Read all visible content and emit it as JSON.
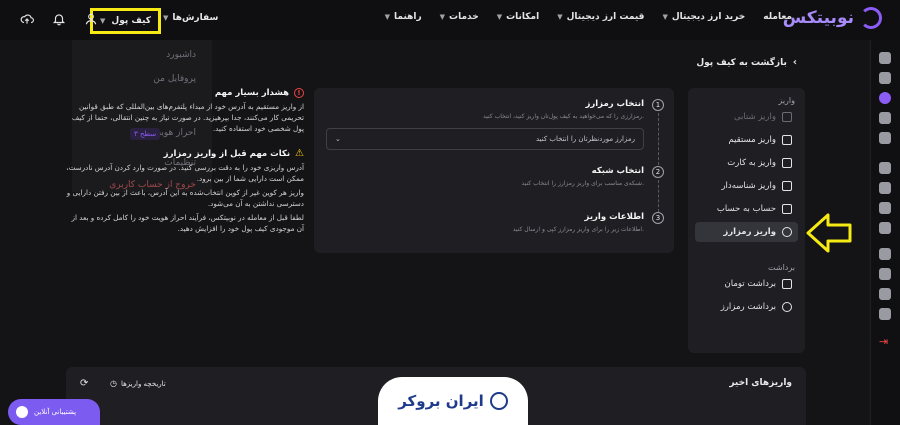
{
  "brand": {
    "name": "نوبیتکس",
    "accent": "#8b5cf6"
  },
  "nav": {
    "items": [
      "معامله",
      "خرید ارز دیجیتال",
      "قیمت ارز دیجیتال",
      "امکانات",
      "خدمات",
      "راهنما"
    ],
    "orders": "سفارش‌ها",
    "wallet": "کیف پول"
  },
  "dropdown": {
    "items": [
      "داشبورد",
      "پروفایل من",
      "احراز هویت",
      "تنظیمات",
      "خروج از حساب کاربری"
    ],
    "level_badge": "سطح ۳"
  },
  "back": "بازگشت به کیف پول",
  "sidemenu": {
    "deposit_section": "واریز",
    "deposit_items": [
      "واریز شتابی",
      "واریز مستقیم",
      "واریز به کارت",
      "واریز شناسه‌دار",
      "حساب به حساب",
      "واریز رمزارز"
    ],
    "withdraw_section": "برداشت",
    "withdraw_items": [
      "برداشت تومان",
      "برداشت رمزارز"
    ]
  },
  "steps": [
    {
      "num": "1",
      "title": "انتخاب رمزارز",
      "desc": "رمزارزی را که می‌خواهید به کیف پول‌تان واریز کنید، انتخاب کنید."
    },
    {
      "num": "2",
      "title": "انتخاب شبکه",
      "desc": "شبکه‌ی مناسب برای واریز رمزارز را انتخاب کنید."
    },
    {
      "num": "3",
      "title": "اطلاعات واریز",
      "desc": "اطلاعات زیر را برای واریز رمزارز کپی و ارسال کنید."
    }
  ],
  "select": {
    "placeholder": "رمزارز موردنظرتان را انتخاب کنید"
  },
  "warnings": [
    {
      "title": "هشدار بسیار مهم",
      "body": "از واریز مستقیم به آدرس خود از مبداء پلتفرم‌های بین‌المللی که طبق قوانین تحریمی کار می‌کنند، جدا بپرهیزید. در صورت نیاز به چنین انتقالی، حتما از کیف پول شخصی خود استفاده کنید."
    },
    {
      "title": "نکات مهم قبل از واریز رمزارز",
      "body": "آدرس واریزی خود را به دقت بررسی کنید. در صورت وارد کردن آدرس نادرست، ممکن است دارایی شما از بین برود.",
      "body2": "واریز هر کوین غیر از کوین انتخاب‌شده به این آدرس، باعث از بین رفتن دارایی و دسترسی نداشتن به آن می‌شود.",
      "body3": "لطفا قبل از معامله در نوبیتکس، فرآیند احراز هویت خود را کامل کرده و بعد از آن موجودی کیف پول خود را افزایش دهید."
    }
  ],
  "recent": {
    "title": "واریزهای اخیر",
    "history": "تاریخچه واریزها"
  },
  "watermark": "ایران بروکر",
  "chat": "پشتیبانی آنلاین"
}
